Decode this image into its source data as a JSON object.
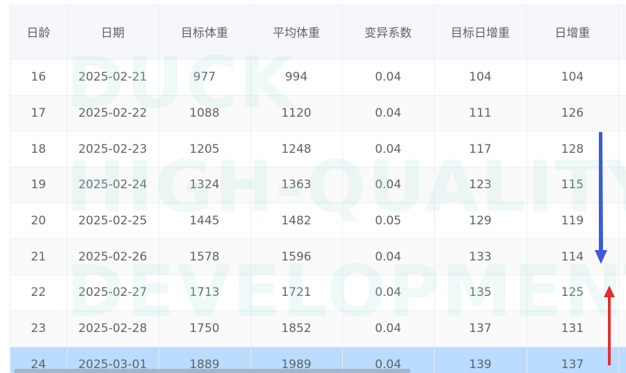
{
  "table": {
    "headers": [
      "日龄",
      "日期",
      "目标体重",
      "平均体重",
      "变异系数",
      "目标日增重",
      "日增重"
    ],
    "rows": [
      [
        "16",
        "2025-02-21",
        "977",
        "994",
        "0.04",
        "104",
        "104"
      ],
      [
        "17",
        "2025-02-22",
        "1088",
        "1120",
        "0.04",
        "111",
        "126"
      ],
      [
        "18",
        "2025-02-23",
        "1205",
        "1248",
        "0.04",
        "117",
        "128"
      ],
      [
        "19",
        "2025-02-24",
        "1324",
        "1363",
        "0.04",
        "123",
        "115"
      ],
      [
        "20",
        "2025-02-25",
        "1445",
        "1482",
        "0.05",
        "129",
        "119"
      ],
      [
        "21",
        "2025-02-26",
        "1578",
        "1596",
        "0.04",
        "133",
        "114"
      ],
      [
        "22",
        "2025-02-27",
        "1713",
        "1721",
        "0.04",
        "135",
        "125"
      ],
      [
        "23",
        "2025-02-28",
        "1750",
        "1852",
        "0.04",
        "137",
        "131"
      ],
      [
        "24",
        "2025-03-01",
        "1889",
        "1989",
        "0.04",
        "139",
        "137"
      ]
    ],
    "selected_row_index": 8
  },
  "watermark": {
    "lines": [
      "DUCK",
      "HIGH-QUALITY",
      "DEVELOPMENT"
    ]
  },
  "annotations": {
    "down_arrow_color": "#3b5bdb",
    "up_arrow_color": "#e03131"
  },
  "colors": {
    "header_bg": "#f5f7fa",
    "stripe_bg": "#fafafa",
    "selected_bg": "#b9dcff",
    "text": "#606266"
  }
}
